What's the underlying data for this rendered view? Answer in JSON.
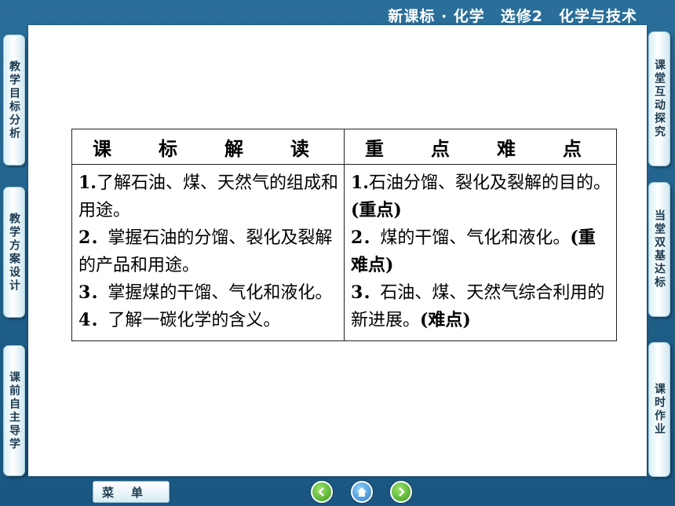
{
  "header": {
    "title": "新课标 · 化学　选修2　化学与技术"
  },
  "left_tabs": [
    "教学目标分析",
    "教学方案设计",
    "课前自主导学"
  ],
  "right_tabs": [
    "课堂互动探究",
    "当堂双基达标",
    "课时作业"
  ],
  "table": {
    "headers": [
      "课　标　解　读",
      "重　点　难　点"
    ],
    "left": [
      {
        "num": "1.",
        "text": "了解石油、煤、天然气的组成和用途。"
      },
      {
        "num": "2．",
        "text": "掌握石油的分馏、裂化及裂解的产品和用途。"
      },
      {
        "num": "3．",
        "text": "掌握煤的干馏、气化和液化。"
      },
      {
        "num": "4．",
        "text": "了解一碳化学的含义。"
      }
    ],
    "right": [
      {
        "num": "1.",
        "text": "石油分馏、裂化及裂解的目的。",
        "tag": "(重点)"
      },
      {
        "num": "2．",
        "text": "煤的干馏、气化和液化。",
        "tag": "(重难点)"
      },
      {
        "num": "3．",
        "text": "石油、煤、天然气综合利用的新进展。",
        "tag": "(难点)"
      }
    ]
  },
  "footer": {
    "menu_label": "菜单",
    "icons": [
      "prev-icon",
      "home-icon",
      "next-icon"
    ]
  }
}
